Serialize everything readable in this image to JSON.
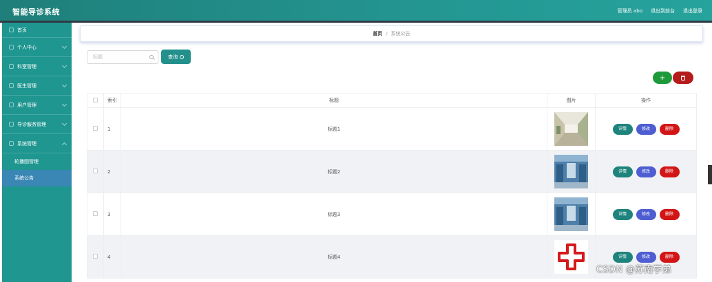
{
  "app": {
    "title": "智能导诊系统"
  },
  "header": {
    "admin_label": "管理员 abo",
    "back_label": "退出到前台",
    "logout_label": "退出登录"
  },
  "sidebar": {
    "items": [
      {
        "label": "首页"
      },
      {
        "label": "个人中心"
      },
      {
        "label": "科室管理"
      },
      {
        "label": "医生管理"
      },
      {
        "label": "用户管理"
      },
      {
        "label": "导诊服务管理"
      },
      {
        "label": "系统管理"
      }
    ],
    "subitems": [
      {
        "label": "轮播图管理"
      },
      {
        "label": "系统公告",
        "active": true
      }
    ]
  },
  "breadcrumb": {
    "home": "首页",
    "separator": "/",
    "current": "系统公告"
  },
  "search": {
    "placeholder": "标题",
    "button_label": "查询"
  },
  "actions": {
    "add_label": "+"
  },
  "table": {
    "headers": {
      "index": "索引",
      "title": "标题",
      "image": "图片",
      "ops": "操作"
    },
    "rows": [
      {
        "index": "1",
        "title": "标题1",
        "image": "hospital-corridor"
      },
      {
        "index": "2",
        "title": "标题2",
        "image": "blue-ward"
      },
      {
        "index": "3",
        "title": "标题3",
        "image": "blue-ward"
      },
      {
        "index": "4",
        "title": "标题4",
        "image": "red-cross"
      }
    ],
    "buttons": {
      "detail": "详情",
      "edit": "修改",
      "delete": "删除"
    }
  },
  "watermark": "CSDN @苏南学弟",
  "colors": {
    "header": "#249692",
    "sidebar": "#1f9690",
    "active_sub": "#3a86b5",
    "detail": "#1e837d",
    "edit": "#4e5ed2",
    "delete": "#d21616",
    "add": "#1e9a3a",
    "bulk_delete": "#b51b1b"
  }
}
